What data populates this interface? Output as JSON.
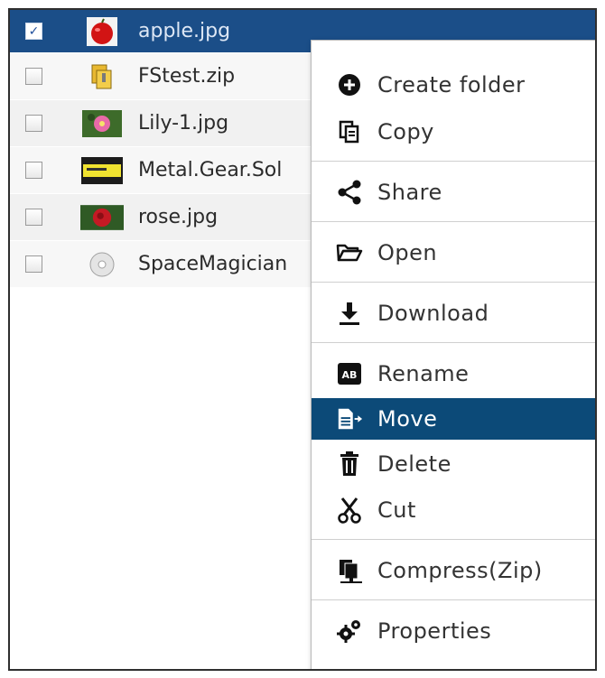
{
  "files": [
    {
      "name": "apple.jpg",
      "checked": true,
      "icon": "apple-thumbnail"
    },
    {
      "name": "FStest.zip",
      "checked": false,
      "icon": "zip-archive-icon"
    },
    {
      "name": "Lily-1.jpg",
      "checked": false,
      "icon": "lily-thumbnail"
    },
    {
      "name": "Metal.Gear.Sol",
      "checked": false,
      "icon": "metal-gear-thumbnail"
    },
    {
      "name": "rose.jpg",
      "checked": false,
      "icon": "rose-thumbnail"
    },
    {
      "name": "SpaceMagician",
      "checked": false,
      "icon": "disc-image-icon"
    }
  ],
  "menu": {
    "items": [
      {
        "label": "Create folder",
        "icon": "plus-circle-icon"
      },
      {
        "label": "Copy",
        "icon": "copy-icon"
      },
      {
        "label": "Share",
        "icon": "share-icon"
      },
      {
        "label": "Open",
        "icon": "folder-open-icon"
      },
      {
        "label": "Download",
        "icon": "download-icon"
      },
      {
        "label": "Rename",
        "icon": "rename-icon"
      },
      {
        "label": "Move",
        "icon": "move-icon",
        "highlighted": true
      },
      {
        "label": "Delete",
        "icon": "trash-icon"
      },
      {
        "label": "Cut",
        "icon": "scissors-icon"
      },
      {
        "label": "Compress(Zip)",
        "icon": "compress-icon"
      },
      {
        "label": "Properties",
        "icon": "gears-icon"
      }
    ]
  },
  "colors": {
    "selection": "#1b4e88",
    "menu_highlight": "#0c4a78",
    "text": "#333333"
  }
}
